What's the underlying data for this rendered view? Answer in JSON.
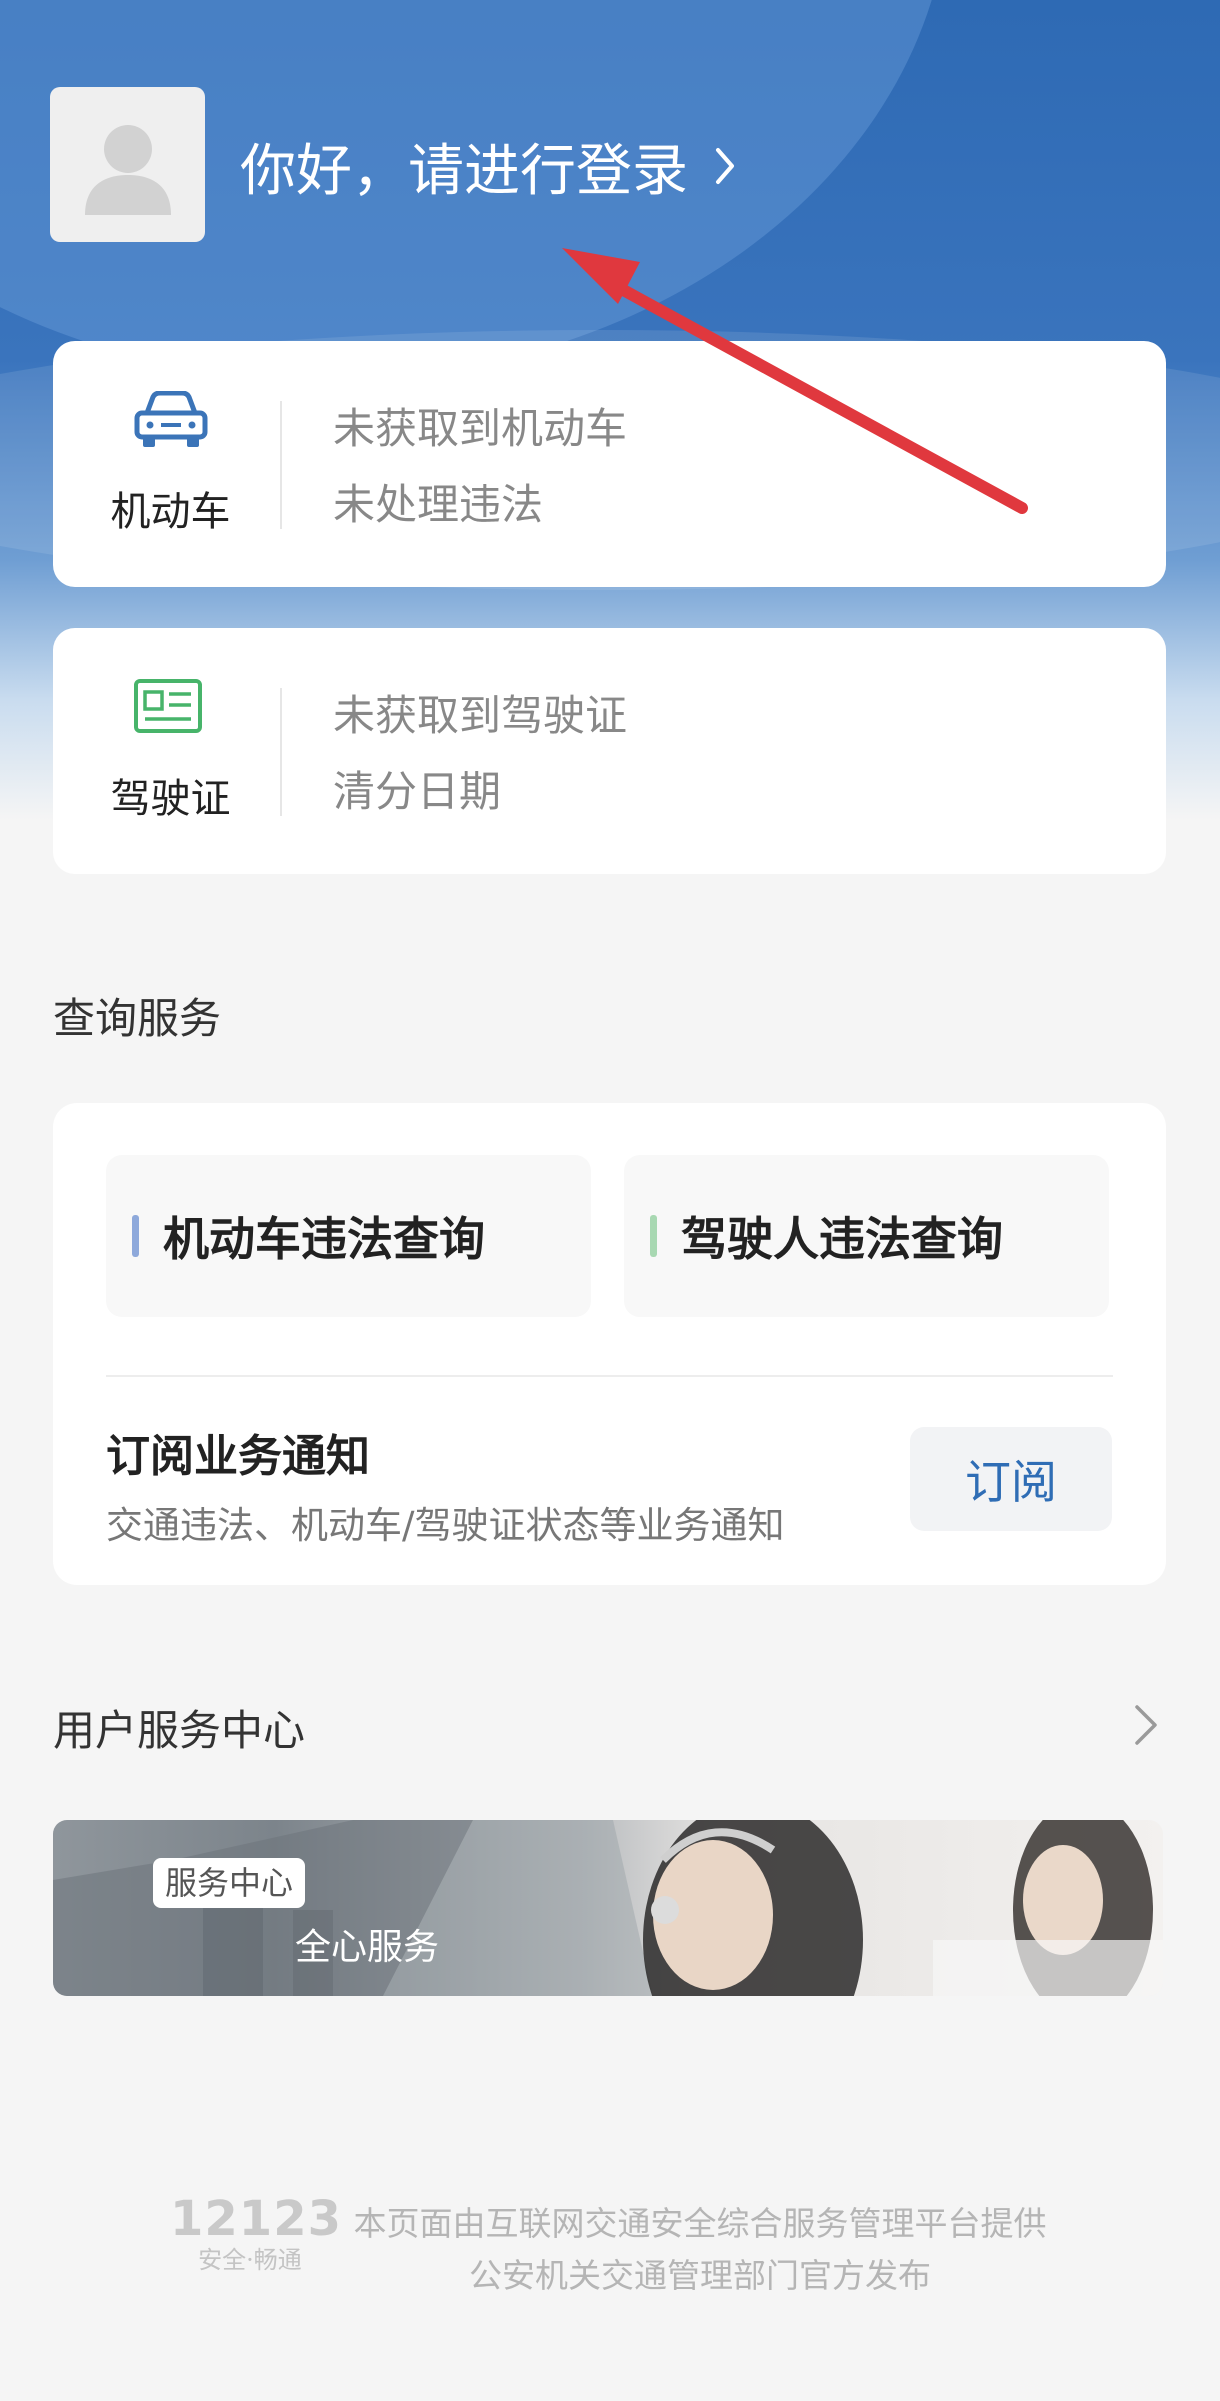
{
  "header": {
    "login_text": "你好，请进行登录",
    "chevron_icon": "chevron-right-icon"
  },
  "vehicle_card": {
    "label": "机动车",
    "line1": "未获取到机动车",
    "line2": "未处理违法",
    "icon": "car-icon"
  },
  "license_card": {
    "label": "驾驶证",
    "line1": "未获取到驾驶证",
    "line2": "清分日期",
    "icon": "id-card-icon"
  },
  "query_section": {
    "title": "查询服务",
    "tiles": [
      {
        "label": "机动车违法查询",
        "accent": "#8ea9db"
      },
      {
        "label": "驾驶人违法查询",
        "accent": "#a8d8b2"
      }
    ],
    "subscribe": {
      "title": "订阅业务通知",
      "desc": "交通违法、机动车/驾驶证状态等业务通知",
      "button": "订阅"
    }
  },
  "service_section": {
    "title": "用户服务中心",
    "banner_tag": "服务中心",
    "banner_tagline": "全心服务"
  },
  "footer": {
    "logo_number": "12123",
    "logo_motto": "安全·畅通",
    "line1": "本页面由互联网交通安全综合服务管理平台提供",
    "line2": "公安机关交通管理部门官方发布"
  },
  "colors": {
    "brand_blue": "#2e6ab4",
    "annotation_arrow": "#e0383e",
    "link_blue": "#2f6db5"
  }
}
